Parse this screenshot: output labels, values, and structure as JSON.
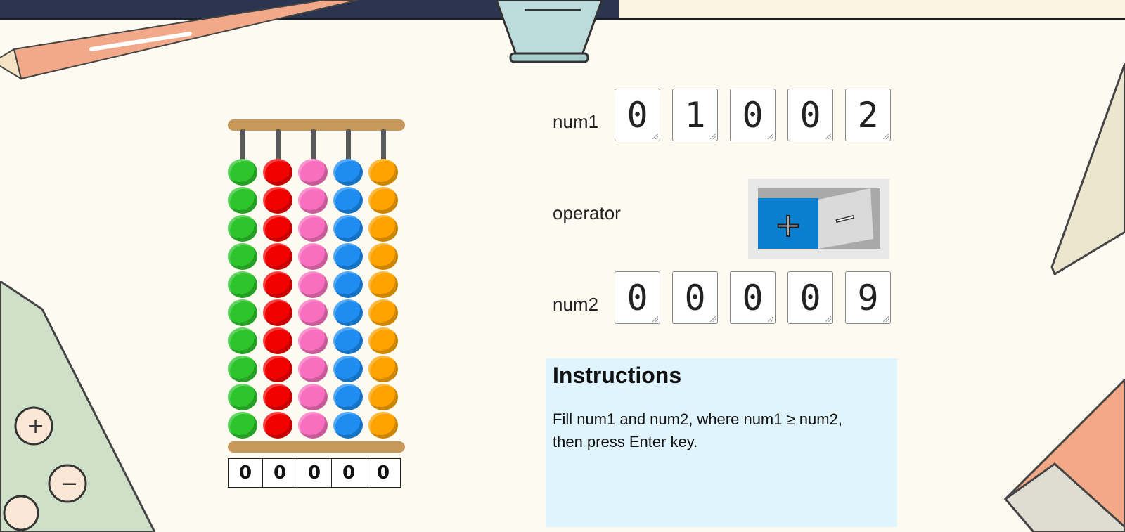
{
  "abacus": {
    "columns": [
      {
        "color": "#2ec42e",
        "beads": 10
      },
      {
        "color": "#f20000",
        "beads": 10
      },
      {
        "color": "#f76fbe",
        "beads": 10
      },
      {
        "color": "#1e8cf0",
        "beads": 10
      },
      {
        "color": "#fca300",
        "beads": 10
      }
    ],
    "digits": [
      "0",
      "0",
      "0",
      "0",
      "0"
    ]
  },
  "form": {
    "num1_label": "num1",
    "num1_digits": [
      "0",
      "1",
      "0",
      "0",
      "2"
    ],
    "operator_label": "operator",
    "operator_selected": "+",
    "operator_options": [
      "+",
      "−"
    ],
    "operator_selected_color": "#0a7fd0",
    "num2_label": "num2",
    "num2_digits": [
      "0",
      "0",
      "0",
      "0",
      "9"
    ]
  },
  "instructions": {
    "title": "Instructions",
    "text": "Fill num1 and num2, where num1 ≥ num2, then press Enter key."
  }
}
